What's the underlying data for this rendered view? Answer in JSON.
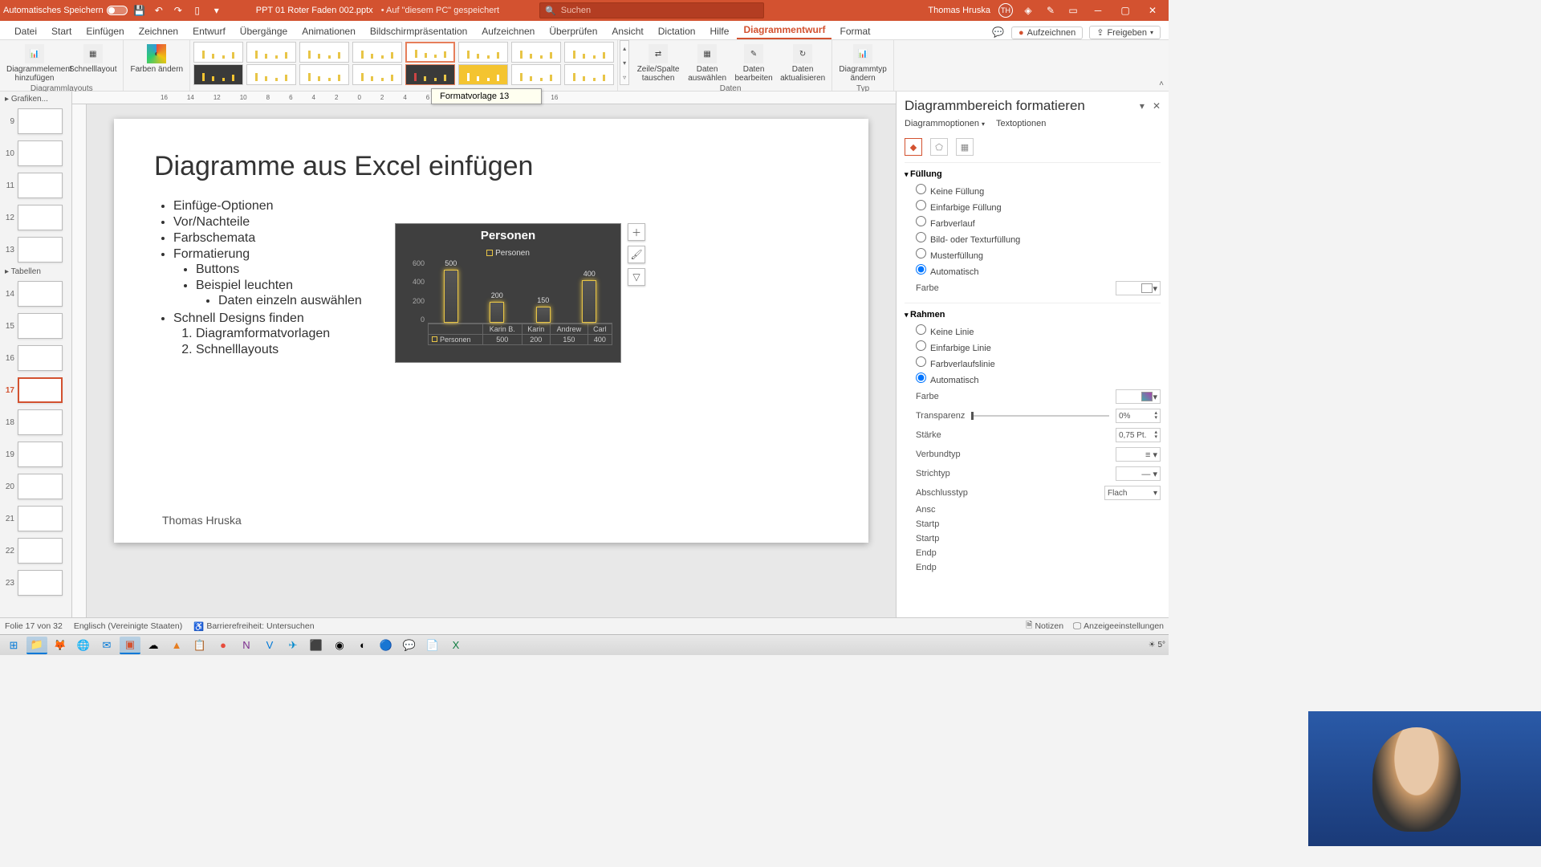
{
  "titlebar": {
    "auto_save": "Automatisches Speichern",
    "doc_name": "PPT 01 Roter Faden 002.pptx",
    "doc_status": "• Auf \"diesem PC\" gespeichert",
    "search_placeholder": "Suchen",
    "user_name": "Thomas Hruska",
    "user_initials": "TH"
  },
  "tabs": {
    "items": [
      "Datei",
      "Start",
      "Einfügen",
      "Zeichnen",
      "Entwurf",
      "Übergänge",
      "Animationen",
      "Bildschirmpräsentation",
      "Aufzeichnen",
      "Überprüfen",
      "Ansicht",
      "Dictation",
      "Hilfe",
      "Diagrammentwurf",
      "Format"
    ],
    "active": "Diagrammentwurf",
    "record_btn": "Aufzeichnen",
    "share_btn": "Freigeben"
  },
  "ribbon": {
    "g1_btn1": "Diagrammelement hinzufügen",
    "g1_btn2": "Schnelllayout",
    "g1_label": "Diagrammlayouts",
    "g2_btn1": "Farben ändern",
    "style_tooltip": "Formatvorlage 13",
    "g3_btn1": "Zeile/Spalte tauschen",
    "g3_btn2": "Daten auswählen",
    "g3_btn3": "Daten bearbeiten",
    "g3_btn4": "Daten aktualisieren",
    "g3_label": "Daten",
    "g4_btn1": "Diagrammtyp ändern",
    "g4_label": "Typ"
  },
  "panel": {
    "section1": "Grafiken...",
    "section2": "Tabellen",
    "slides": [
      {
        "num": "9"
      },
      {
        "num": "10"
      },
      {
        "num": "11"
      },
      {
        "num": "12"
      },
      {
        "num": "13"
      }
    ],
    "slides2": [
      {
        "num": "14"
      },
      {
        "num": "15"
      },
      {
        "num": "16"
      },
      {
        "num": "17"
      },
      {
        "num": "18"
      },
      {
        "num": "19"
      },
      {
        "num": "20"
      },
      {
        "num": "21"
      },
      {
        "num": "22"
      },
      {
        "num": "23"
      }
    ]
  },
  "slide": {
    "title": "Diagramme aus Excel einfügen",
    "b1": "Einfüge-Optionen",
    "b2": "Vor/Nachteile",
    "b3": "Farbschemata",
    "b4": "Formatierung",
    "b4a": "Buttons",
    "b4b": "Beispiel leuchten",
    "b4b1": "Daten einzeln auswählen",
    "b5": "Schnell Designs finden",
    "b5a": "Diagramformatvorlagen",
    "b5b": "Schnelllayouts",
    "footer": "Thomas Hruska"
  },
  "chart_data": {
    "type": "bar",
    "title": "Personen",
    "legend": "Personen",
    "ylabel": "",
    "ylim": [
      0,
      600
    ],
    "yticks": [
      "600",
      "400",
      "200",
      "0"
    ],
    "categories": [
      "Karin B.",
      "Karin",
      "Andrew",
      "Carl"
    ],
    "values": [
      500,
      200,
      150,
      400
    ],
    "row_label": "Personen"
  },
  "pane": {
    "title": "Diagrammbereich formatieren",
    "tab1": "Diagrammoptionen",
    "tab2": "Textoptionen",
    "sec_fill": "Füllung",
    "fill_none": "Keine Füllung",
    "fill_solid": "Einfarbige Füllung",
    "fill_grad": "Farbverlauf",
    "fill_pic": "Bild- oder Texturfüllung",
    "fill_patt": "Musterfüllung",
    "fill_auto": "Automatisch",
    "color": "Farbe",
    "sec_border": "Rahmen",
    "bd_none": "Keine Linie",
    "bd_solid": "Einfarbige Linie",
    "bd_grad": "Farbverlaufslinie",
    "bd_auto": "Automatisch",
    "transp": "Transparenz",
    "transp_val": "0%",
    "width": "Stärke",
    "width_val": "0,75 Pt.",
    "compound": "Verbundtyp",
    "dash": "Strichtyp",
    "cap_lbl": "Abschlusstyp",
    "cap_val": "Flach",
    "prop_join": "Ansc",
    "prop_start_arrow": "Startp",
    "prop_start_size": "Startp",
    "prop_end_arrow": "Endp",
    "prop_end_size": "Endp"
  },
  "status": {
    "slide_info": "Folie 17 von 32",
    "lang": "Englisch (Vereinigte Staaten)",
    "access": "Barrierefreiheit: Untersuchen",
    "notes": "Notizen",
    "display": "Anzeigeeinstellungen"
  },
  "taskbar": {
    "temp": "5°"
  }
}
